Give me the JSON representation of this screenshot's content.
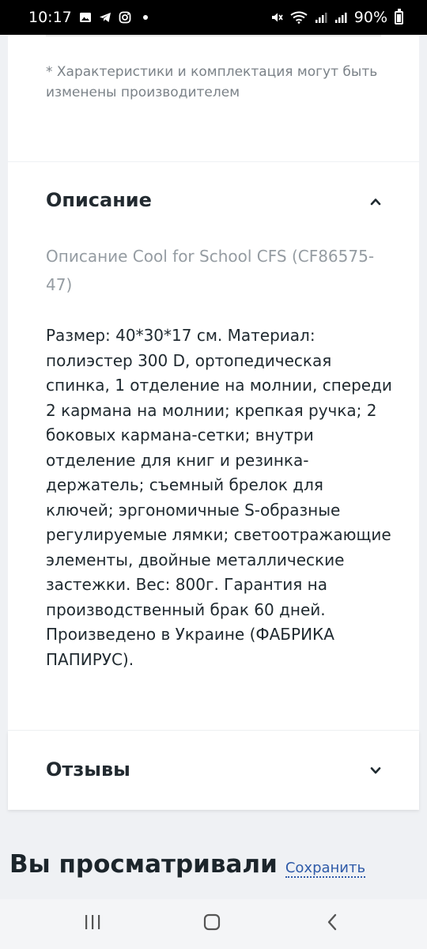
{
  "status_bar": {
    "time": "10:17",
    "battery": "90%",
    "left_icons": [
      "gallery-icon",
      "telegram-icon",
      "instagram-icon",
      "dot"
    ],
    "right_icons": [
      "mute-icon",
      "wifi-icon",
      "signal-icon",
      "signal-icon",
      "battery-icon"
    ]
  },
  "specs": {
    "disclaimer": "* Характеристики и комплектация могут быть изменены производителем"
  },
  "description": {
    "title": "Описание",
    "subtitle": "Описание Cool for School CFS (CF86575-47)",
    "body": "Размер: 40*30*17 см. Материал: полиэстер 300 D, ортопедическая спинка, 1 отделение на молнии, спереди 2 кармана на молнии; крепкая ручка; 2 боковых кармана-сетки; внутри отделение для книг и резинка-держатель; съемный брелок для ключей; эргономичные S-образные регулируемые лямки; светоотражающие элементы, двойные металлические застежки. Вес: 800г. Гарантия на производственный брак 60 дней. Произведено в Украине (ФАБРИКА ПАПИРУС).",
    "expanded": true
  },
  "reviews": {
    "title": "Отзывы",
    "expanded": false
  },
  "viewed": {
    "title": "Вы просматривали",
    "save_label": "Сохранить"
  },
  "nav": {
    "buttons": [
      "recent-apps",
      "home",
      "back"
    ]
  },
  "colors": {
    "page_bg": "#eff1f4",
    "card_bg": "#ffffff",
    "link": "#2e5aa8",
    "muted": "#959ca2"
  }
}
